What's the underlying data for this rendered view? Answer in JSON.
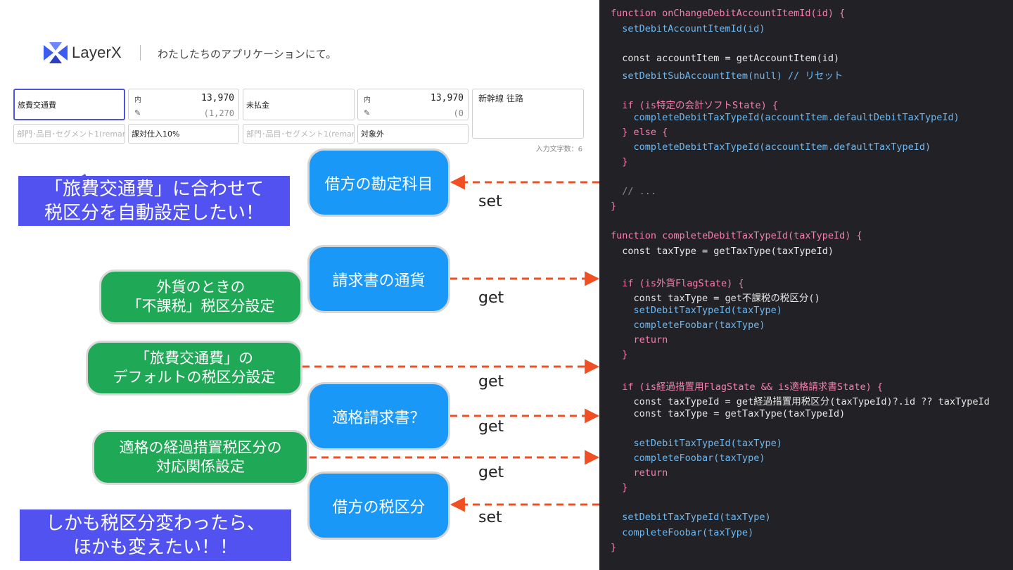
{
  "header": {
    "logo_text": "LayerX",
    "tagline": "わたしたちのアプリケーションにて。"
  },
  "form": {
    "account_item": "旅費交通費",
    "amount1_label1": "内",
    "amount1_value1": "13,970",
    "amount1_value2": "(1,270",
    "segment_placeholder": "部門･品目･セグメント1(remar",
    "tax_category": "課対仕入10%",
    "account2": "未払金",
    "amount2_label1": "内",
    "amount2_value1": "13,970",
    "amount2_value2": "(0",
    "segment2_placeholder": "部門･品目･セグメント1(remar",
    "tax_category2": "対象外",
    "memo": "新幹線 往路",
    "char_count": "入力文字数：6"
  },
  "callouts": {
    "purple_top": "「旅費交通費」に合わせて\n税区分を自動設定したい！",
    "purple_bottom": "しかも税区分変わったら、\nほかも変えたい！！",
    "green_1": "外貨のときの\n「不課税」税区分設定",
    "green_2": "「旅費交通費」の\nデフォルトの税区分設定",
    "green_3": "適格の経過措置税区分の\n対応関係設定"
  },
  "nodes": {
    "debit_account": "借方の勘定科目",
    "invoice_currency": "請求書の通貨",
    "qualified_invoice": "適格請求書？",
    "debit_tax": "借方の税区分"
  },
  "arrow_labels": {
    "set1": "set",
    "get1": "get",
    "get2": "get",
    "get3": "get",
    "get4": "get",
    "set2": "set"
  },
  "code": {
    "l1": "function onChangeDebitAccountItemId(id) {",
    "l2": "  setDebitAccountItemId(id)",
    "l3": "  const accountItem = getAccountItem(id)",
    "l4": "  setDebitSubAccountItem(null) // リセット",
    "l5": "  if (is特定の会計ソフトState) {",
    "l6": "    completeDebitTaxTypeId(accountItem.defaultDebitTaxTypeId)",
    "l7": "  } else {",
    "l8": "    completeDebitTaxTypeId(accountItem.defaultTaxTypeId)",
    "l9": "  }",
    "l10": "  // ...",
    "l11": "}",
    "l12": "function completeDebitTaxTypeId(taxTypeId) {",
    "l13": "  const taxType = getTaxType(taxTypeId)",
    "l14": "  if (is外貨FlagState) {",
    "l15": "    const taxType = get不課税の税区分()",
    "l16": "    setDebitTaxTypeId(taxType)",
    "l17": "    completeFoobar(taxType)",
    "l18": "    return",
    "l19": "  }",
    "l20": "  if (is経過措置用FlagState && is適格請求書State) {",
    "l21": "    const taxTypeId = get経過措置用税区分(taxTypeId)?.id ?? taxTypeId",
    "l22": "    const taxType = getTaxType(taxTypeId)",
    "l23": "    setDebitTaxTypeId(taxType)",
    "l24": "    completeFoobar(taxType)",
    "l25": "    return",
    "l26": "  }",
    "l27": "  setDebitTaxTypeId(taxType)",
    "l28": "  completeFoobar(taxType)",
    "l29": "}"
  },
  "colors": {
    "purple": "#5252f0",
    "green": "#1fa855",
    "blue": "#1998f7",
    "arrow": "#f04e23",
    "code_bg": "#222226"
  }
}
